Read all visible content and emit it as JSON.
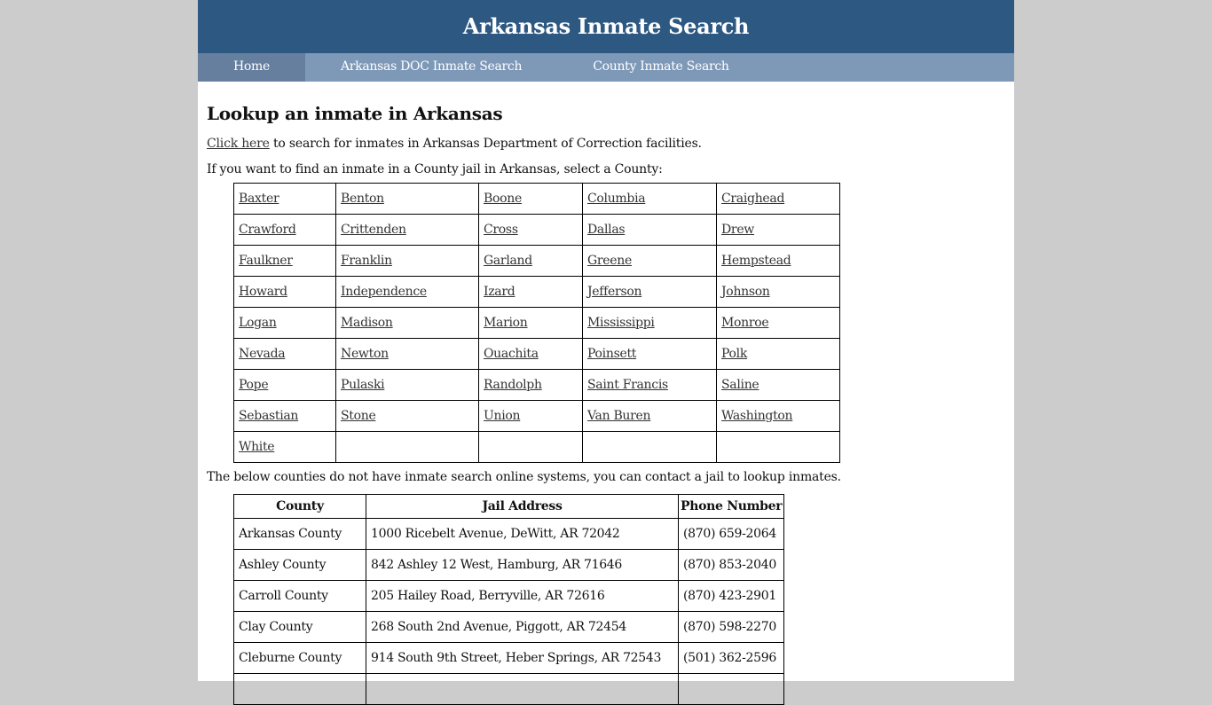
{
  "header": {
    "title": "Arkansas Inmate Search"
  },
  "nav": {
    "items": [
      {
        "label": "Home",
        "active": true
      },
      {
        "label": "Arkansas DOC Inmate Search",
        "active": false
      },
      {
        "label": "County Inmate Search",
        "active": false
      }
    ]
  },
  "main": {
    "heading": "Lookup an inmate in Arkansas",
    "doc_link_label": "Click here",
    "doc_text": " to search for inmates in Arkansas Department of Correction facilities.",
    "county_intro": "If you want to find an inmate in a County jail in Arkansas, select a County:",
    "counties": [
      [
        "Baxter",
        "Benton",
        "Boone",
        "Columbia",
        "Craighead"
      ],
      [
        "Crawford",
        "Crittenden",
        "Cross",
        "Dallas",
        "Drew"
      ],
      [
        "Faulkner",
        "Franklin",
        "Garland",
        "Greene",
        "Hempstead"
      ],
      [
        "Howard",
        "Independence",
        "Izard",
        "Jefferson",
        "Johnson"
      ],
      [
        "Logan",
        "Madison",
        "Marion",
        "Mississippi",
        "Monroe"
      ],
      [
        "Nevada",
        "Newton",
        "Ouachita",
        "Poinsett",
        "Polk"
      ],
      [
        "Pope",
        "Pulaski",
        "Randolph",
        "Saint Francis",
        "Saline"
      ],
      [
        "Sebastian",
        "Stone",
        "Union",
        "Van Buren",
        "Washington"
      ],
      [
        "White",
        "",
        "",
        "",
        ""
      ]
    ],
    "no_online_text": "The below counties do not have inmate search online systems, you can contact a jail to lookup inmates.",
    "jail_table": {
      "headers": [
        "County",
        "Jail Address",
        "Phone Number"
      ],
      "rows": [
        [
          "Arkansas County",
          "1000 Ricebelt Avenue, DeWitt, AR 72042",
          "(870) 659-2064"
        ],
        [
          "Ashley County",
          "842 Ashley 12 West, Hamburg, AR 71646",
          "(870) 853-2040"
        ],
        [
          "Carroll County",
          "205 Hailey Road, Berryville, AR 72616",
          "(870) 423-2901"
        ],
        [
          "Clay County",
          "268 South 2nd Avenue, Piggott, AR 72454",
          "(870) 598-2270"
        ],
        [
          "Cleburne County",
          "914 South 9th Street, Heber Springs, AR 72543",
          "(501) 362-2596"
        ],
        [
          "",
          "",
          ""
        ]
      ]
    }
  }
}
